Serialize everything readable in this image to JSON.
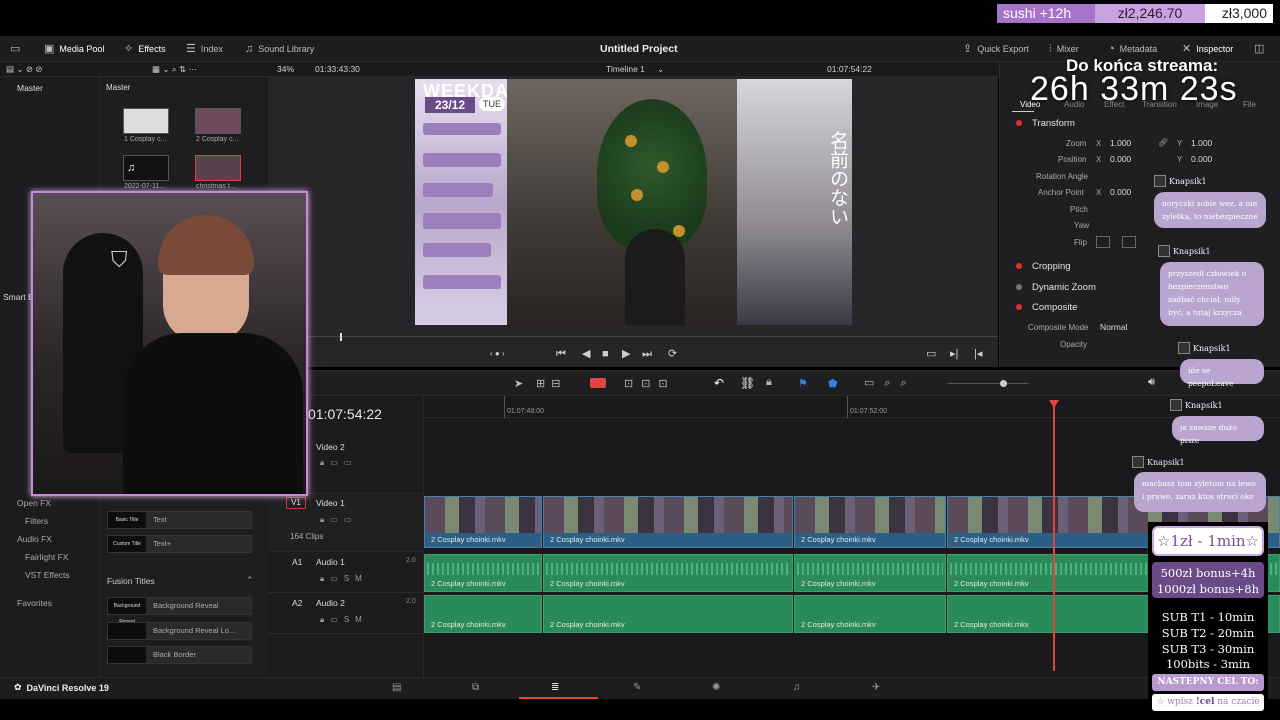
{
  "overlay": {
    "sushi": "sushi +12h",
    "amount": "zł2,246.70",
    "goal": "zł3,000",
    "stream_label": "Do końca streama:",
    "countdown": "26h 33m 23s"
  },
  "header": {
    "media_pool": "Media Pool",
    "effects": "Effects",
    "index": "Index",
    "sound_library": "Sound Library",
    "project_title": "Untitled Project",
    "quick_export": "Quick Export",
    "mixer": "Mixer",
    "metadata": "Metadata",
    "inspector": "Inspector"
  },
  "subbar": {
    "zoom": "34%",
    "source_tc": "01:33:43:30",
    "timeline_name": "Timeline 1",
    "record_tc": "01:07:54:22"
  },
  "bins": {
    "master": "Master",
    "pool_master": "Master",
    "smart_bins": "Smart Bins",
    "open_fx": "Open FX",
    "filters": "Filters",
    "audio_fx": "Audio FX",
    "fairlight_fx": "Fairlight FX",
    "vst_effects": "VST Effects",
    "favorites": "Favorites"
  },
  "media_clips": [
    {
      "label": "1 Cosplay c..."
    },
    {
      "label": "2 Cosplay c..."
    },
    {
      "label": "2022-07-11..."
    },
    {
      "label": "christmas t..."
    }
  ],
  "effects_list": {
    "titles": [
      {
        "swatch": "Basic Title",
        "name": "Text"
      },
      {
        "swatch": "Custom Title",
        "name": "Text+"
      }
    ],
    "fusion_header": "Fusion Titles",
    "fusion": [
      {
        "swatch": "Background Reveal",
        "name": "Background Reveal"
      },
      {
        "swatch": "",
        "name": "Background Reveal Lo..."
      },
      {
        "swatch": "",
        "name": "Black Border"
      }
    ]
  },
  "video": {
    "title": "WEEKDAY",
    "date": "23/12",
    "day": "TUE",
    "vertical": "名前のない"
  },
  "inspector": {
    "tabs": [
      "Video",
      "Audio",
      "Effect",
      "Transition",
      "Image",
      "File"
    ],
    "transform": "Transform",
    "zoom_label": "Zoom",
    "zoom_x": "1.000",
    "zoom_y": "1.000",
    "position_label": "Position",
    "pos_x": "0.000",
    "pos_y": "0.000",
    "rotation_label": "Rotation Angle",
    "anchor_label": "Anchor Point",
    "anchor_x": "0.000",
    "pitch_label": "Pitch",
    "yaw_label": "Yaw",
    "flip_label": "Flip",
    "cropping": "Cropping",
    "dynamic_zoom": "Dynamic Zoom",
    "composite": "Composite",
    "composite_mode_label": "Composite Mode",
    "composite_mode": "Normal",
    "opacity_label": "Opacity"
  },
  "timeline": {
    "timecode": "01:07:54:22",
    "ruler": [
      "01:07:48:00",
      "01:07:52:00"
    ],
    "tracks": [
      {
        "id": "",
        "name": "Video 2",
        "sub": ""
      },
      {
        "id": "V1",
        "name": "Video 1",
        "sub": "164 Clips"
      },
      {
        "id": "A1",
        "name": "Audio 1",
        "sub": "2.0"
      },
      {
        "id": "A2",
        "name": "Audio 2",
        "sub": "2.0"
      }
    ],
    "clip_name": "2 Cosplay choinki.mkv"
  },
  "footer": {
    "app": "DaVinci Resolve 19"
  },
  "chat": [
    {
      "user": "Knapsik1",
      "text": "noryczki sobie wez, a nie żyletka, to niebezpieczne"
    },
    {
      "user": "Knapsik1",
      "text": "przyszedł człowiek o bezpieczenstwo zadbać chciał, miły być, a tutaj krzycza"
    },
    {
      "user": "Knapsik1",
      "text": "ide se peepoLeave"
    },
    {
      "user": "Knapsik1",
      "text": "ja zawsze dużo pisze"
    },
    {
      "user": "Knapsik1",
      "text": "machasz tom zyletom na lewo i prawo, zaraz ktos straci oko"
    }
  ],
  "donation": {
    "rate": "☆1zł - 1min☆",
    "bonus1": "500zł bonus+4h",
    "bonus2": "1000zł bonus+8h",
    "sub1": "SUB T1 - 10min",
    "sub2": "SUB T2 - 20min",
    "sub3": "SUB T3 - 30min",
    "bits": "100bits - 3min",
    "next_goal": "NASTEPNY CEL TO:",
    "cmd_prefix": "☆ wpisz",
    "cmd": "!cel",
    "cmd_suffix": "na czacie"
  },
  "colors": {
    "accent": "#b48bd6",
    "playhead": "#e0443b",
    "video_clip": "#2c5f86",
    "audio_clip": "#2a8a59"
  }
}
